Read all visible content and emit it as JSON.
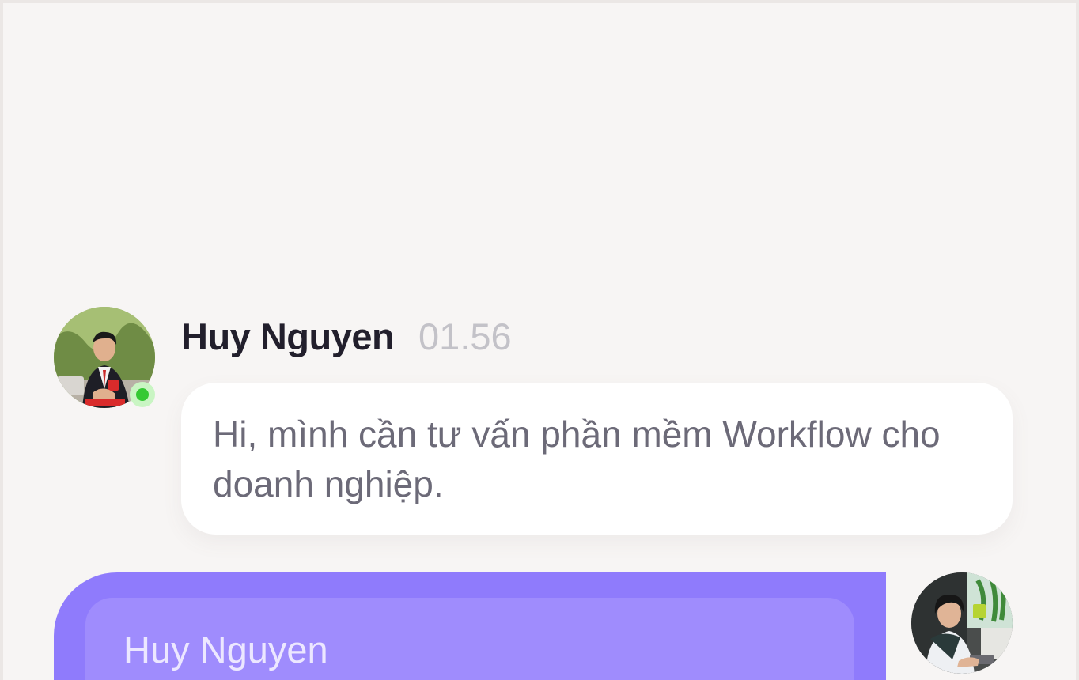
{
  "message_incoming": {
    "sender": "Huy Nguyen",
    "time": "01.56",
    "text": "Hi, mình cần tư vấn phần mềm Workflow cho doanh nghiệp.",
    "online": true
  },
  "message_reply": {
    "quoted_sender": "Huy Nguyen"
  },
  "colors": {
    "background": "#f7f5f4",
    "bubble": "#ffffff",
    "accent": "#8f7bfc",
    "online": "#35c934"
  }
}
